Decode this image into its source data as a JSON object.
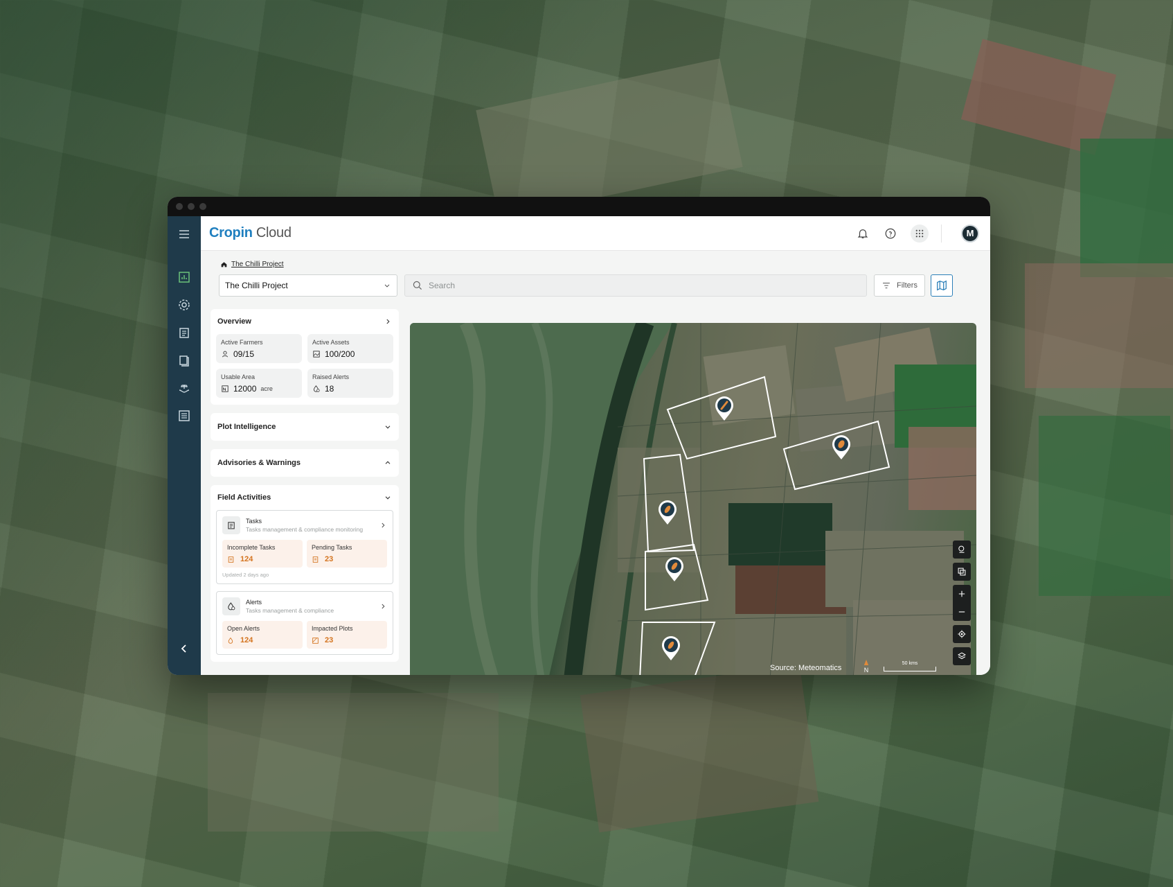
{
  "brand": {
    "name_bold": "Cropin",
    "name_rest": " Cloud"
  },
  "user": {
    "avatar_initial": "M"
  },
  "breadcrumb": {
    "current": "The Chilli Project"
  },
  "project_select": {
    "value": "The Chilli Project"
  },
  "search": {
    "placeholder": "Search"
  },
  "filters": {
    "label": "Filters"
  },
  "overview": {
    "title": "Overview",
    "stats": [
      {
        "label": "Active Farmers",
        "value": "09/15",
        "unit": ""
      },
      {
        "label": "Active Assets",
        "value": "100/200",
        "unit": ""
      },
      {
        "label": "Usable Area",
        "value": "12000",
        "unit": "acre"
      },
      {
        "label": "Raised Alerts",
        "value": "18",
        "unit": ""
      }
    ]
  },
  "sections": {
    "plot_intelligence": "Plot Intelligence",
    "advisories": "Advisories & Warnings",
    "field_activities": "Field Activities"
  },
  "tasks": {
    "title": "Tasks",
    "desc": "Tasks management & compliance monitoring",
    "incomplete_label": "Incomplete Tasks",
    "incomplete_value": "124",
    "pending_label": "Pending Tasks",
    "pending_value": "23",
    "updated": "Updated 2 days ago"
  },
  "alerts": {
    "title": "Alerts",
    "desc": "Tasks management & compliance",
    "open_label": "Open Alerts",
    "open_value": "124",
    "impacted_label": "Impacted Plots",
    "impacted_value": "23"
  },
  "map": {
    "source": "Source: Meteomatics",
    "north": "N",
    "scale": "50 kms"
  },
  "colors": {
    "accent": "#1f7fbf",
    "rail": "#1f3a4a",
    "orange": "#d4741f"
  }
}
